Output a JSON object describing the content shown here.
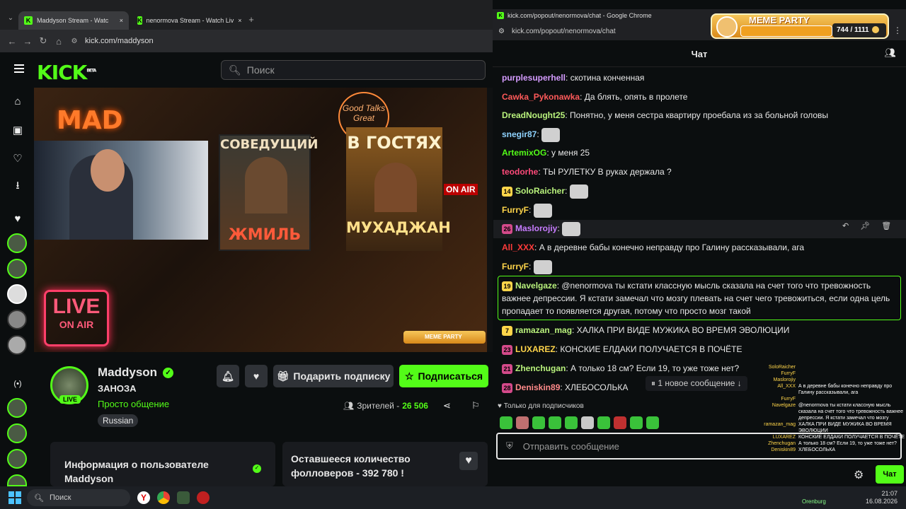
{
  "left_browser": {
    "tabs": [
      {
        "label": "Maddyson Stream - Watc"
      },
      {
        "label": "nenormova Stream - Watch Liv"
      }
    ],
    "url": "kick.com/maddyson",
    "search_placeholder": "Поиск"
  },
  "sidebar": {
    "live_label": "(•)"
  },
  "video": {
    "mad_text": "MAD",
    "poster1_title": "СОВЕДУЩИЙ",
    "poster1_bottom": "ЖМИЛЬ",
    "poster2_title": "В ГОСТЯХ",
    "poster2_bottom": "МУХАДЖАН",
    "sign_text": "Good Talks Great",
    "on_air": "ON AIR",
    "live_sign_top": "LIVE",
    "live_sign_bottom": "ON AIR",
    "meme_widget": "MEME PARTY"
  },
  "channel": {
    "name": "Maddyson",
    "title": "ЗАНОЗА",
    "category": "Просто общение",
    "language": "Russian",
    "live_badge": "LIVE",
    "gift_button": "Подарить подписку",
    "subscribe_button": "Подписаться",
    "viewers_label": "Зрителей - ",
    "viewers_count": "26 506",
    "info_card": "Информация о пользователе Maddyson",
    "followers_card": "Оставшееся количество фолловеров - 392 780 !"
  },
  "right_window": {
    "title": "kick.com/popout/nenormova/chat - Google Chrome",
    "url": "kick.com/popout/nenormova/chat",
    "chat_title": "Чат",
    "meme_party": {
      "label": "MEME PARTY",
      "progress": "744 / 1111",
      "fraction": 0.67
    }
  },
  "chat": [
    {
      "user": "purplesuperhell",
      "color": "#d59cff",
      "text": "скотина конченная"
    },
    {
      "user": "Cawka_Pykonawka",
      "color": "#ff5a5a",
      "text": "Да блять, опять в пролете"
    },
    {
      "user": "DreadNought25",
      "color": "#b9f27c",
      "text": "Понятно, у меня сестра квартиру проебала из за больной головы"
    },
    {
      "user": "snegir87",
      "color": "#8fd3ff",
      "text": ""
    },
    {
      "user": "ArtemixOG",
      "color": "#53fc18",
      "text": "у меня 25"
    },
    {
      "user": "teodorhe",
      "color": "#ff4a7a",
      "text": "ТЫ РУЛЕТКУ В руках держала ?"
    },
    {
      "user": "SoloRaicher",
      "color": "#b9f27c",
      "text": "",
      "badge": "14"
    },
    {
      "user": "FurryF",
      "color": "#ffd54a",
      "text": ""
    },
    {
      "user": "Maslorojiy",
      "color": "#c87cff",
      "text": "",
      "badge": "26"
    },
    {
      "user": "All_XXX",
      "color": "#ff3b3b",
      "text": "А в деревне бабы конечно неправду про Галину рассказывали, ага"
    },
    {
      "user": "FurryF",
      "color": "#ffd54a",
      "text": ""
    },
    {
      "user": "Navelgaze",
      "color": "#b9f27c",
      "text": "@nenormova ты кстати классную мысль сказала на счет того что тревожность важнее депрессии. Я кстати замечал что мозгу плевать на счет чего тревожиться, если одна цель пропадает то появляется другая, потому что просто мозг такой",
      "badge": "19"
    },
    {
      "user": "ramazan_mag",
      "color": "#b9f27c",
      "text": "ХАЛКА ПРИ ВИДЕ МУЖИКА ВО ВРЕМЯ ЭВОЛЮЦИИ",
      "badge": "7"
    },
    {
      "user": "LUXAREZ",
      "color": "#ffd54a",
      "text": "КОНСКИЕ ЕЛДАКИ ПОЛУЧАЕТСЯ В ПОЧЁТЕ",
      "badge": "23"
    },
    {
      "user": "Zhenchugan",
      "color": "#b9f27c",
      "text": "А только 18 см? Если 19, то уже тоже нет?",
      "badge": "21"
    },
    {
      "user": "Deniskin89",
      "color": "#ff8a8a",
      "text": "ХЛЕБОСОЛЬКА",
      "badge": "28"
    }
  ],
  "chat_ui": {
    "new_messages": "1 новое сообщение",
    "subs_only": "Только для подписчиков",
    "send_placeholder": "Отправить сообщение",
    "chat_button": "Чат"
  },
  "overlay_chat": [
    {
      "user": "SoloRaicher",
      "text": ""
    },
    {
      "user": "FurryF",
      "text": ""
    },
    {
      "user": "Maslorojiy",
      "text": ""
    },
    {
      "user": "All_XXX",
      "text": "А в деревне бабы конечно неправду про Галину рассказывали, ага"
    },
    {
      "user": "FurryF",
      "text": ""
    },
    {
      "user": "Navelgaze",
      "text": "@nenormova ты кстати классную мысль сказала на счет того что тревожность важнее депрессии. Я кстати замечал что мозгу плевать на счет чего тревожиться, если одна цель пропадает то появляется другая, потому что просто мозг такой"
    },
    {
      "user": "ramazan_mag",
      "text": "ХАЛКА ПРИ ВИДЕ МУЖИКА ВО ВРЕМЯ ЭВОЛЮЦИИ"
    },
    {
      "user": "LUXAREZ",
      "text": "КОНСКИЕ ЕЛДАКИ ПОЛУЧАЕТСЯ В ПОЧЁТЕ"
    },
    {
      "user": "Zhenchugan",
      "text": "А только 18 см? Если 19, то уже тоже нет?"
    },
    {
      "user": "Deniskin89",
      "text": "ХЛЕБОСОЛЬКА"
    }
  ],
  "taskbar": {
    "search": "Поиск",
    "time": "21:07",
    "date": "16.08.2026",
    "location": "Orenburg"
  }
}
